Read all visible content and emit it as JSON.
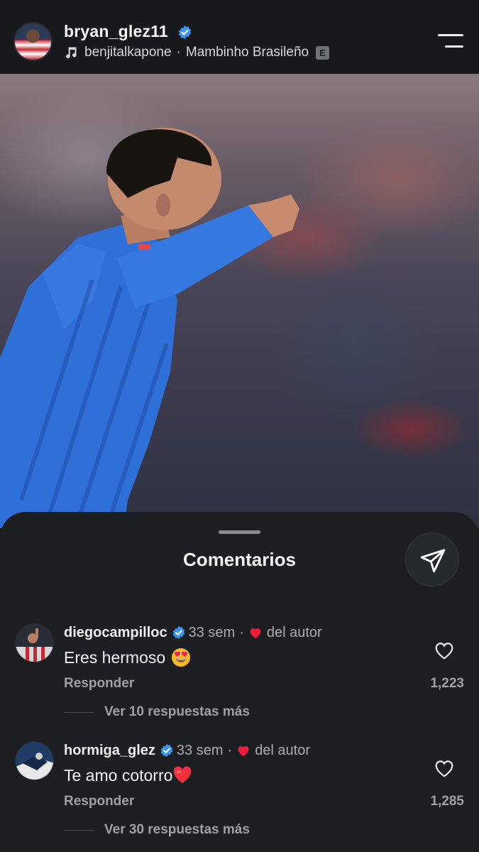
{
  "header": {
    "username": "bryan_glez11",
    "music_artist": "benjitalkapone",
    "music_separator": "·",
    "music_track": "Mambinho Brasileño",
    "explicit_badge": "E",
    "icons": {
      "verified": "verified-badge-icon",
      "music": "music-note-icon",
      "menu": "menu-icon"
    }
  },
  "comments_sheet": {
    "title": "Comentarios",
    "share_icon": "send-icon",
    "comments": [
      {
        "username": "diegocampilloc",
        "age": "33 sem",
        "separator": "·",
        "author_label": "del autor",
        "text": "Eres hermoso",
        "emoji": "heart-eyes-emoji",
        "reply_label": "Responder",
        "like_count": "1,223",
        "view_replies": "Ver 10 respuestas más"
      },
      {
        "username": "hormiga_glez",
        "age": "33 sem",
        "separator": "·",
        "author_label": "del autor",
        "text": "Te amo cotorro",
        "emoji": "red-heart-emoji",
        "reply_label": "Responder",
        "like_count": "1,285",
        "view_replies": "Ver 30 respuestas más"
      }
    ]
  },
  "colors": {
    "background": "#141619",
    "sheet": "#1c1e21",
    "verified_blue": "#3897f0",
    "heart_red": "#ed1c3a",
    "jersey_blue": "#2f6fd8",
    "secondary_text": "#9da0a5"
  }
}
